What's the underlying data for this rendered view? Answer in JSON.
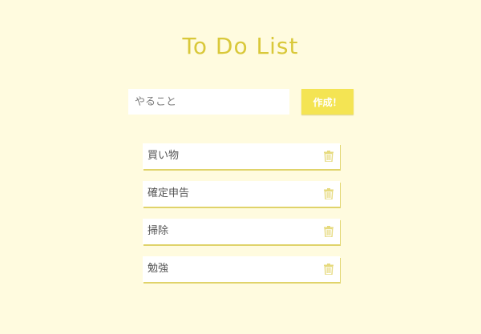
{
  "header": {
    "title": "To Do List"
  },
  "form": {
    "placeholder": "やること",
    "value": "",
    "submit_label": "作成！"
  },
  "todos": [
    {
      "label": "買い物",
      "icon": "trash-icon"
    },
    {
      "label": "確定申告",
      "icon": "trash-icon"
    },
    {
      "label": "掃除",
      "icon": "trash-icon"
    },
    {
      "label": "勉強",
      "icon": "trash-icon"
    }
  ],
  "colors": {
    "background": "#fffbdf",
    "accent": "#f4e453",
    "title": "#d9c83a",
    "icon": "#e6da7e"
  }
}
